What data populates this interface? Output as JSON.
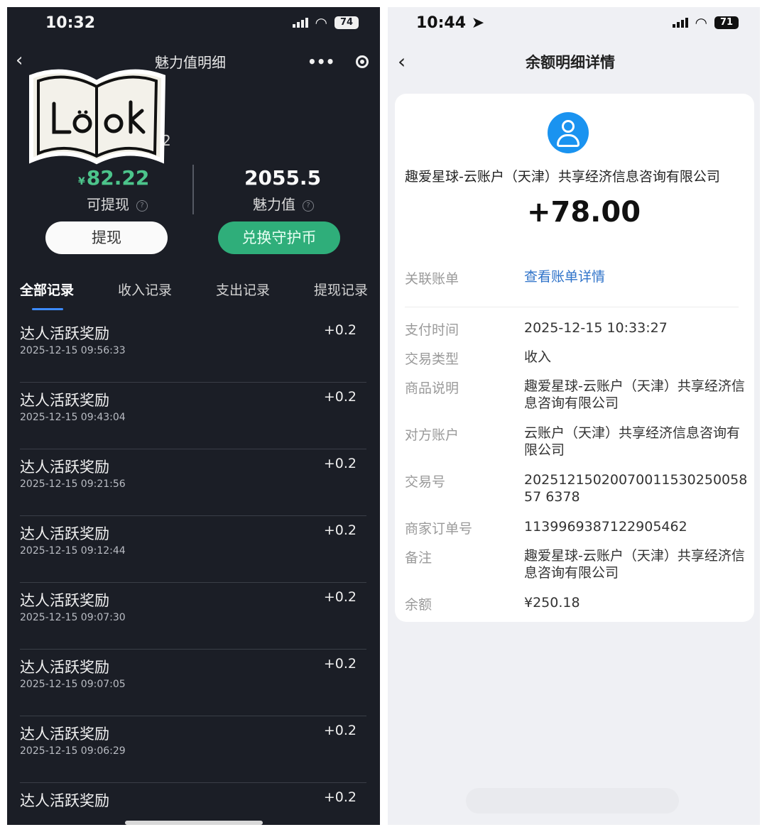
{
  "left": {
    "status": {
      "time": "10:32",
      "battery": "74"
    },
    "nav": {
      "back_icon": "‹",
      "title": "魅力值明细",
      "more_icon": "•••"
    },
    "sticker": {
      "text": "Look"
    },
    "sticker_hidden_text": "2",
    "balance": {
      "currency": "¥",
      "amount": "82.22",
      "label": "可提现"
    },
    "charm": {
      "value": "2055.5",
      "label": "魅力值"
    },
    "buttons": {
      "withdraw": "提现",
      "exchange": "兑换守护币"
    },
    "tabs": [
      "全部记录",
      "收入记录",
      "支出记录",
      "提现记录"
    ],
    "records": [
      {
        "title": "达人活跃奖励",
        "time": "2025-12-15 09:56:33",
        "amount": "+0.2"
      },
      {
        "title": "达人活跃奖励",
        "time": "2025-12-15 09:43:04",
        "amount": "+0.2"
      },
      {
        "title": "达人活跃奖励",
        "time": "2025-12-15 09:21:56",
        "amount": "+0.2"
      },
      {
        "title": "达人活跃奖励",
        "time": "2025-12-15 09:12:44",
        "amount": "+0.2"
      },
      {
        "title": "达人活跃奖励",
        "time": "2025-12-15 09:07:30",
        "amount": "+0.2"
      },
      {
        "title": "达人活跃奖励",
        "time": "2025-12-15 09:07:05",
        "amount": "+0.2"
      },
      {
        "title": "达人活跃奖励",
        "time": "2025-12-15 09:06:29",
        "amount": "+0.2"
      },
      {
        "title": "达人活跃奖励",
        "time": "",
        "amount": "+0.2"
      }
    ]
  },
  "right": {
    "status": {
      "time": "10:44",
      "battery": "71"
    },
    "nav": {
      "back_icon": "‹",
      "title": "余额明细详情"
    },
    "merchant": "趣爱星球-云账户（天津）共享经济信息咨询有限公司",
    "amount": "+78.00",
    "linked": {
      "label": "关联账单",
      "value": "查看账单详情"
    },
    "details": [
      {
        "label": "支付时间",
        "value": "2025-12-15 10:33:27"
      },
      {
        "label": "交易类型",
        "value": "收入"
      },
      {
        "label": "商品说明",
        "value": "趣爱星球-云账户（天津）共享经济信息咨询有限公司"
      },
      {
        "label": "对方账户",
        "value": "云账户（天津）共享经济信息咨询有限公司"
      },
      {
        "label": "交易号",
        "value": "2025121502007001153025005857 6378"
      },
      {
        "label": "商家订单号",
        "value": "1139969387122905462"
      },
      {
        "label": "备注",
        "value": "趣爱星球-云账户（天津）共享经济信息咨询有限公司"
      },
      {
        "label": "余额",
        "value": "¥250.18"
      }
    ]
  }
}
